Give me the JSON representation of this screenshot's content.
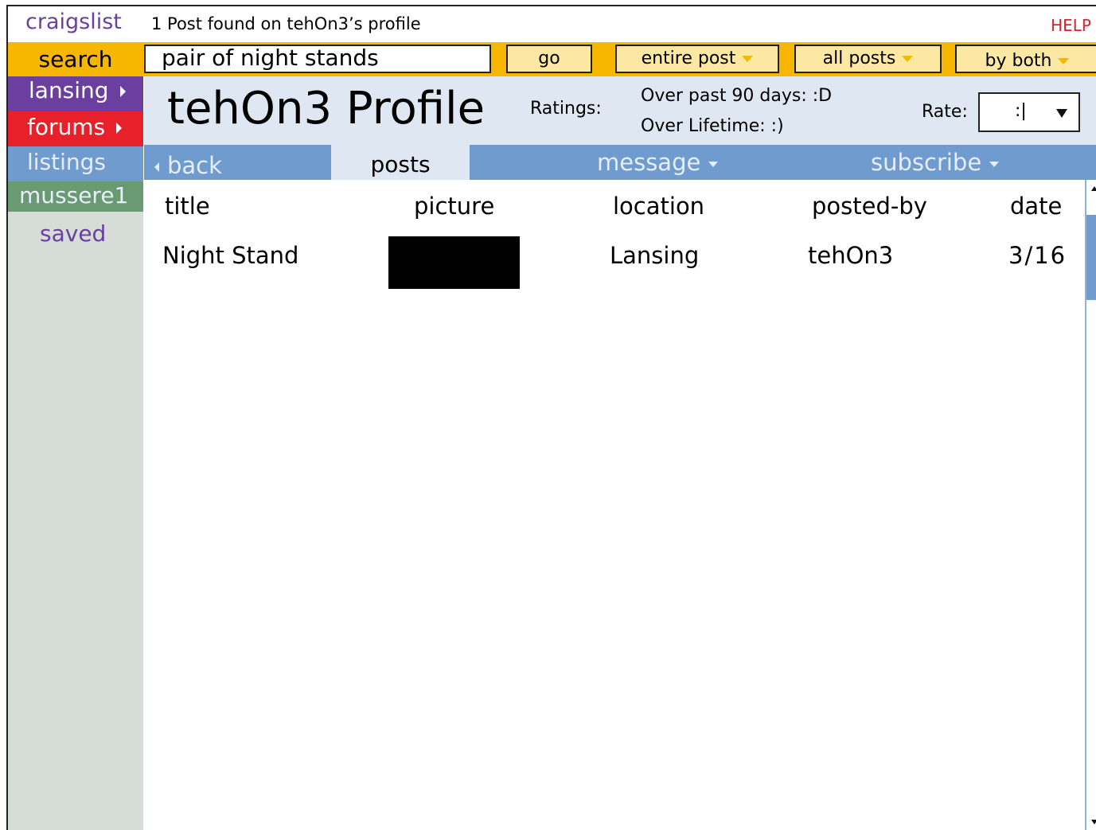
{
  "topbar": {
    "logo": "craigslist",
    "found_text": "1 Post found on tehOn3’s profile",
    "help": "HELP"
  },
  "search": {
    "label": "search",
    "value": "pair of night stands",
    "go": "go",
    "filter_scope": "entire post",
    "filter_posts": "all posts",
    "filter_by": "by both"
  },
  "sidebar": {
    "items": [
      {
        "label": "lansing",
        "color": "#6b3fa0"
      },
      {
        "label": "forums",
        "color": "#e8202a"
      },
      {
        "label": "listings",
        "color": "#6f9bcf"
      },
      {
        "label": "mussere1",
        "color": "#6a9a72"
      },
      {
        "label": "saved",
        "color": "#6b3fa0"
      }
    ]
  },
  "profile": {
    "title": "tehOn3 Profile",
    "ratings_label": "Ratings:",
    "rating_90": "Over past 90 days: :D",
    "rating_lifetime": "Over Lifetime: :)",
    "rate_label": "Rate:",
    "rate_value": ":|"
  },
  "tabs": {
    "back": "back",
    "posts": "posts",
    "message": "message",
    "subscribe": "subscribe"
  },
  "table": {
    "headers": [
      "title",
      "picture",
      "location",
      "posted-by",
      "date"
    ],
    "rows": [
      {
        "title": "Night Stand",
        "location": "Lansing",
        "posted_by": "tehOn3",
        "date": "3/16"
      }
    ]
  },
  "colors": {
    "search_bar": "#f7b600",
    "tab_bar": "#6f9bcf",
    "header_bg": "#dfe8f2",
    "help": "#e0202a"
  }
}
